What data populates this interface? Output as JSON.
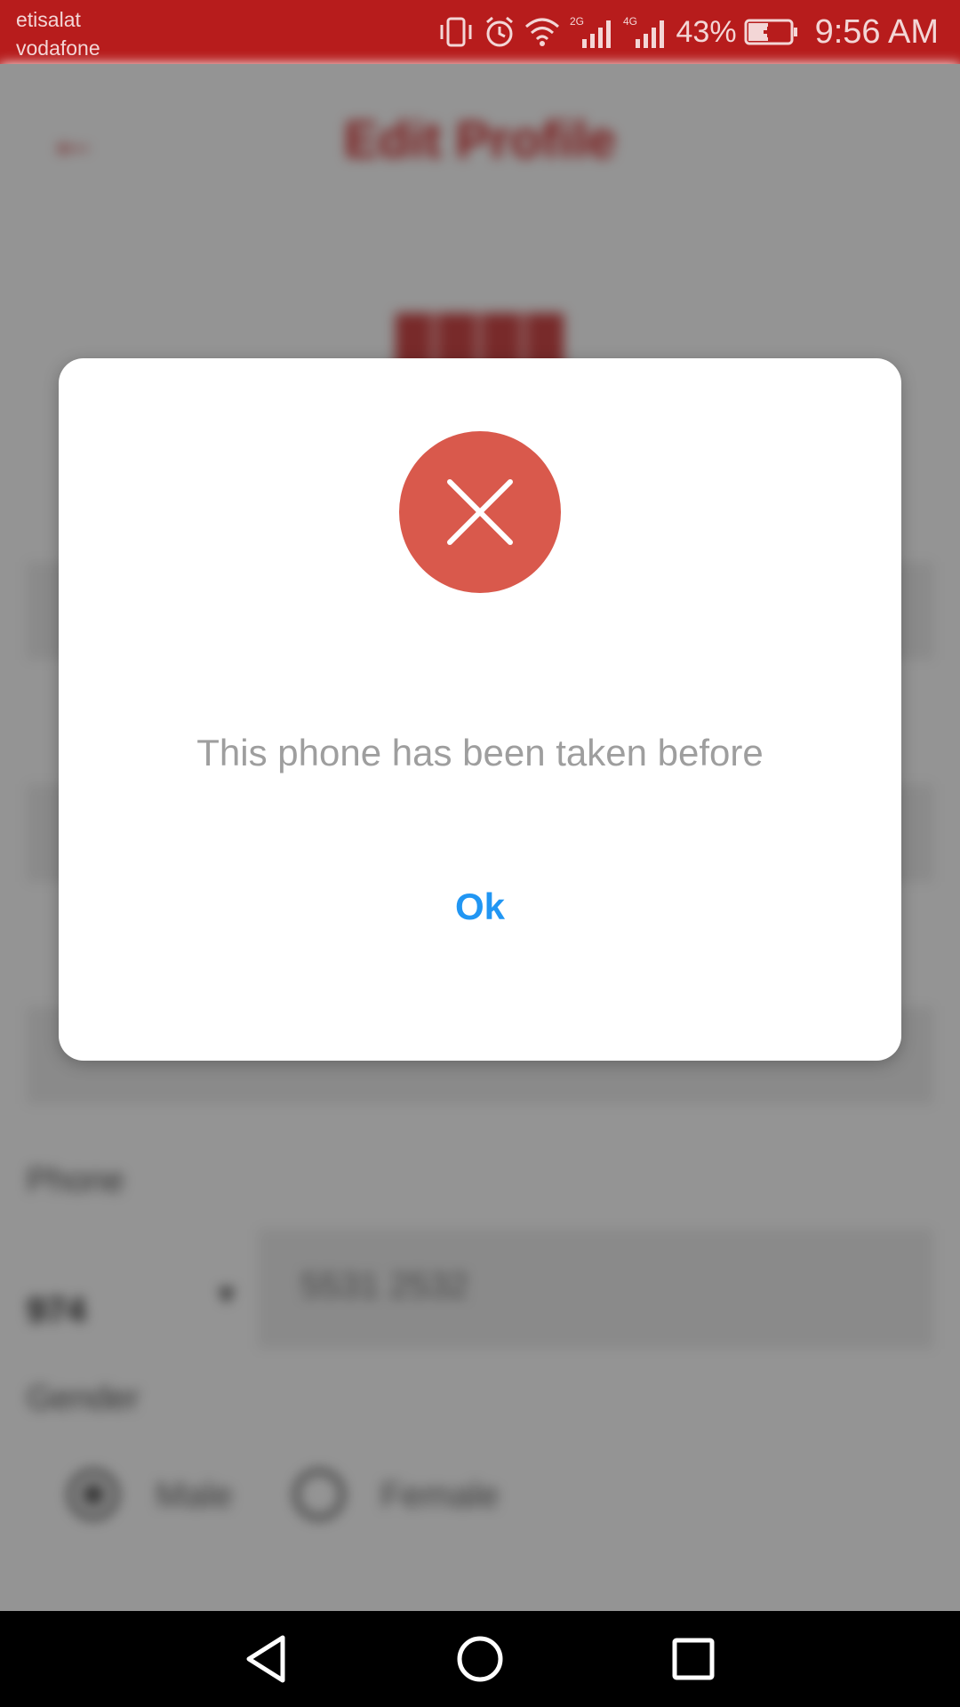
{
  "status_bar": {
    "carrier_1": "etisalat",
    "carrier_2": "vodafone",
    "network_1": "2G",
    "network_2": "4G",
    "battery_percent": "43%",
    "time": "9:56 AM",
    "icons": [
      "vibrate-icon",
      "alarm-icon",
      "wifi-icon",
      "signal-icon",
      "signal-icon",
      "battery-charging-icon"
    ]
  },
  "background_screen": {
    "title": "Edit Profile",
    "phone_label": "Phone",
    "country_code": "974",
    "phone_value": "5531 2532",
    "gender_label": "Gender",
    "gender_options": [
      "Male",
      "Female"
    ]
  },
  "dialog": {
    "icon": "error-x-icon",
    "icon_color": "#d9594c",
    "message": "This phone has been taken before",
    "ok_label": "Ok",
    "ok_color": "#2196f3"
  },
  "nav_bar": {
    "buttons": [
      "back-icon",
      "home-icon",
      "recents-icon"
    ]
  }
}
